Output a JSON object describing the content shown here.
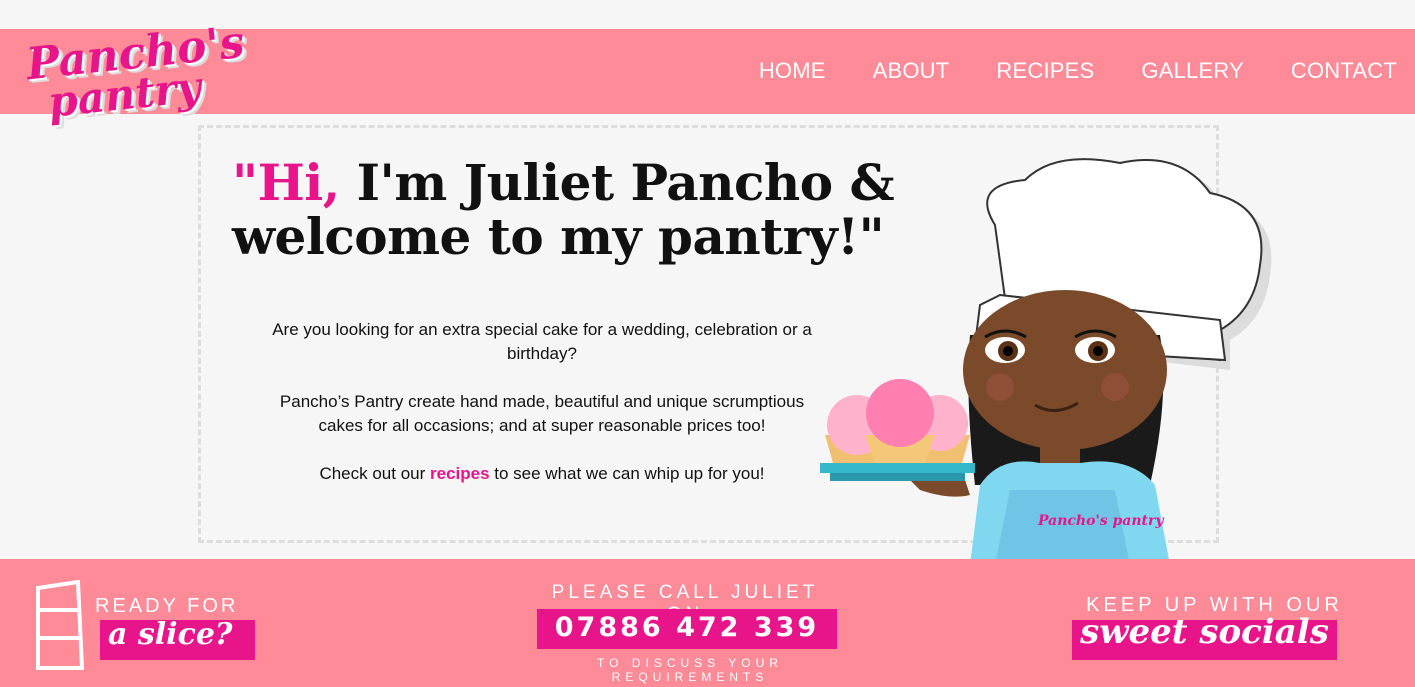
{
  "brand": {
    "logo_line1": "Pancho's",
    "logo_line2": "pantry",
    "apron_text": "Pancho's pantry"
  },
  "nav": {
    "items": [
      {
        "label": "HOME"
      },
      {
        "label": "ABOUT"
      },
      {
        "label": "RECIPES"
      },
      {
        "label": "GALLERY"
      },
      {
        "label": "CONTACT"
      }
    ]
  },
  "hero": {
    "quote_open": "\"",
    "hi": "Hi,",
    "headline_rest1": " I'm Juliet Pancho &",
    "headline_line2": "welcome to my pantry!\"",
    "para1": "Are you looking for an extra special cake for a wedding, celebration or a birthday?",
    "para2": "Pancho’s Pantry create hand made, beautiful and unique scrumptious cakes for all occasions; and at super reasonable prices too!",
    "para3_before": "Check out our ",
    "para3_link": "recipes",
    "para3_after": " to see what we can whip up for you!"
  },
  "footer": {
    "ready": "READY FOR",
    "slice": "a slice?",
    "call": "PLEASE CALL JULIET ON",
    "phone": "07886 472 339",
    "discuss": "TO DISCUSS YOUR REQUIREMENTS",
    "keep": "KEEP UP WITH OUR",
    "socials": "sweet socials"
  },
  "colors": {
    "nav_bg": "#ff8a98",
    "accent": "#e8158a",
    "page_bg": "#f6f6f6"
  }
}
